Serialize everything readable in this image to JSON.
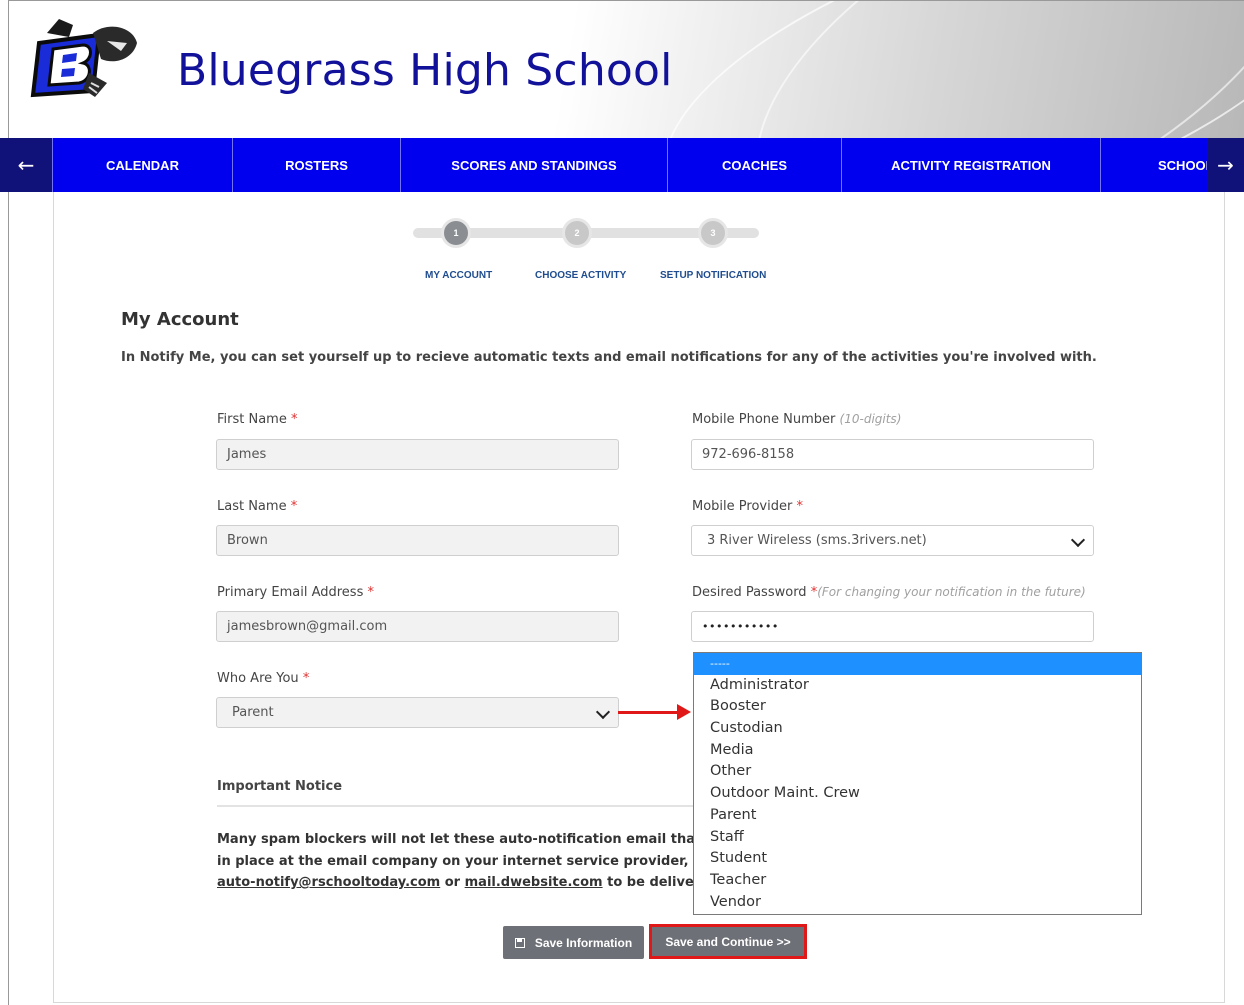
{
  "header": {
    "school_name": "Bluegrass High School"
  },
  "nav": {
    "prev_icon": "arrow-left-icon",
    "next_icon": "arrow-right-icon",
    "items": [
      {
        "label": "CALENDAR"
      },
      {
        "label": "ROSTERS"
      },
      {
        "label": "SCORES AND STANDINGS"
      },
      {
        "label": "COACHES"
      },
      {
        "label": "ACTIVITY REGISTRATION"
      },
      {
        "label": "SCHOOL"
      }
    ]
  },
  "steps": [
    {
      "number": "1",
      "label": "MY ACCOUNT",
      "active": true
    },
    {
      "number": "2",
      "label": "CHOOSE ACTIVITY",
      "active": false
    },
    {
      "number": "3",
      "label": "SETUP NOTIFICATION",
      "active": false
    }
  ],
  "form": {
    "title": "My Account",
    "intro": "In Notify Me, you can set yourself up to recieve automatic texts and email notifications for any of the activities you're involved with.",
    "required_mark": "*",
    "first_name": {
      "label": "First Name",
      "value": "James"
    },
    "last_name": {
      "label": "Last Name",
      "value": "Brown"
    },
    "email": {
      "label": "Primary Email Address",
      "value": "jamesbrown@gmail.com"
    },
    "who_are_you": {
      "label": "Who Are You",
      "value": "Parent"
    },
    "mobile_phone": {
      "label": "Mobile Phone Number",
      "hint": "(10-digits)",
      "value": "972-696-8158"
    },
    "mobile_provider": {
      "label": "Mobile Provider",
      "value": "3 River Wireless (sms.3rivers.net)"
    },
    "password": {
      "label": "Desired Password",
      "hint": "(For changing your notification in the future)",
      "value": "•••••••••••"
    }
  },
  "dropdown": {
    "options": [
      "-----",
      "Administrator",
      "Booster",
      "Custodian",
      "Media",
      "Other",
      "Outdoor Maint. Crew",
      "Parent",
      "Staff",
      "Student",
      "Teacher",
      "Vendor"
    ],
    "highlighted": "-----"
  },
  "notice": {
    "title": "Important Notice",
    "line1": "Many spam blockers will not let these auto-notification email that some",
    "line2": "in place at the email company on your internet service provider, please",
    "link1": "auto-notify@rschooltoday.com",
    "or_text": " or ",
    "link2": "mail.dwebsite.com",
    "line3_tail": " to be delivered to"
  },
  "buttons": {
    "save_label": "Save Information",
    "continue_label": "Save and Continue >>"
  },
  "colors": {
    "nav_bg": "#0000ee",
    "title_color": "#11119a",
    "accent_red": "#e01818",
    "button_gray": "#6d7076"
  }
}
